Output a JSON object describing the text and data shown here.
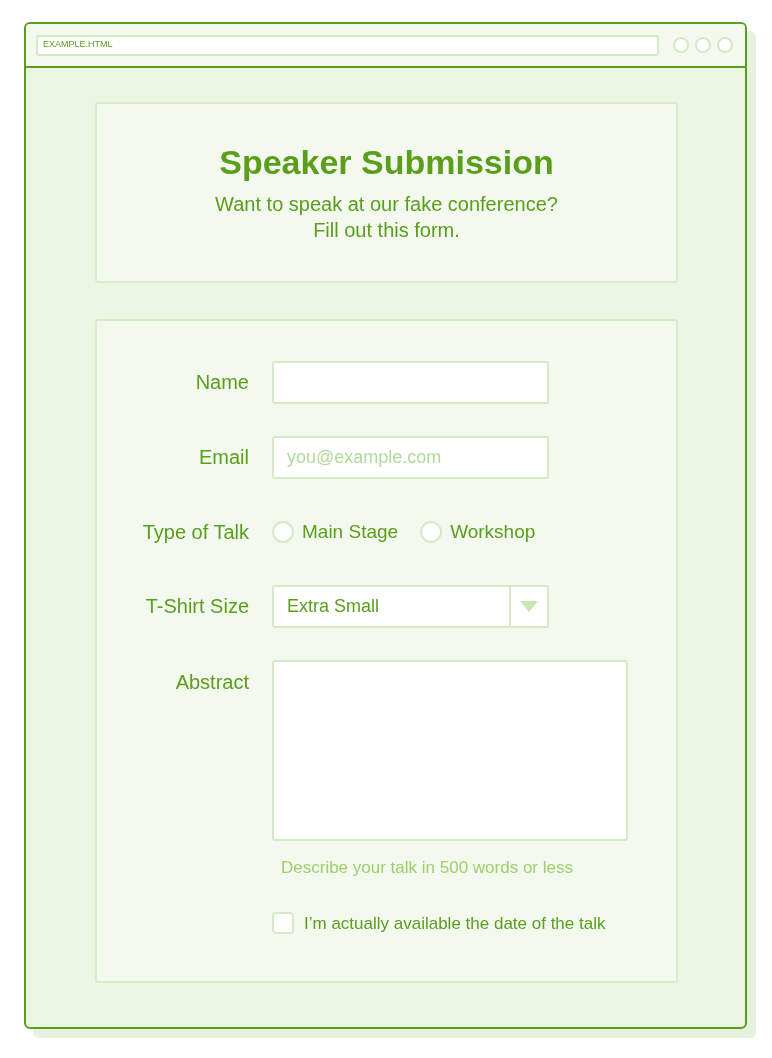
{
  "window": {
    "address": "EXAMPLE.HTML"
  },
  "header": {
    "title": "Speaker Submission",
    "subtitle_lines": [
      "Want to speak at our fake conference?",
      "Fill out this form."
    ]
  },
  "form": {
    "fields": [
      {
        "kind": "text",
        "label": "Name"
      },
      {
        "kind": "email",
        "label": "Email",
        "placeholder": "you@example.com"
      },
      {
        "kind": "radio",
        "label": "Type of Talk",
        "options": [
          {
            "label": "Main Stage",
            "selected": false
          },
          {
            "label": "Workshop",
            "selected": false
          }
        ]
      },
      {
        "kind": "select",
        "label": "T-Shirt Size",
        "value": "Extra Small"
      },
      {
        "kind": "textarea",
        "label": "Abstract",
        "help": "Describe your talk in 500 words or less"
      },
      {
        "kind": "checkbox",
        "label": "I’m actually available the date of the talk",
        "checked": false
      }
    ]
  }
}
